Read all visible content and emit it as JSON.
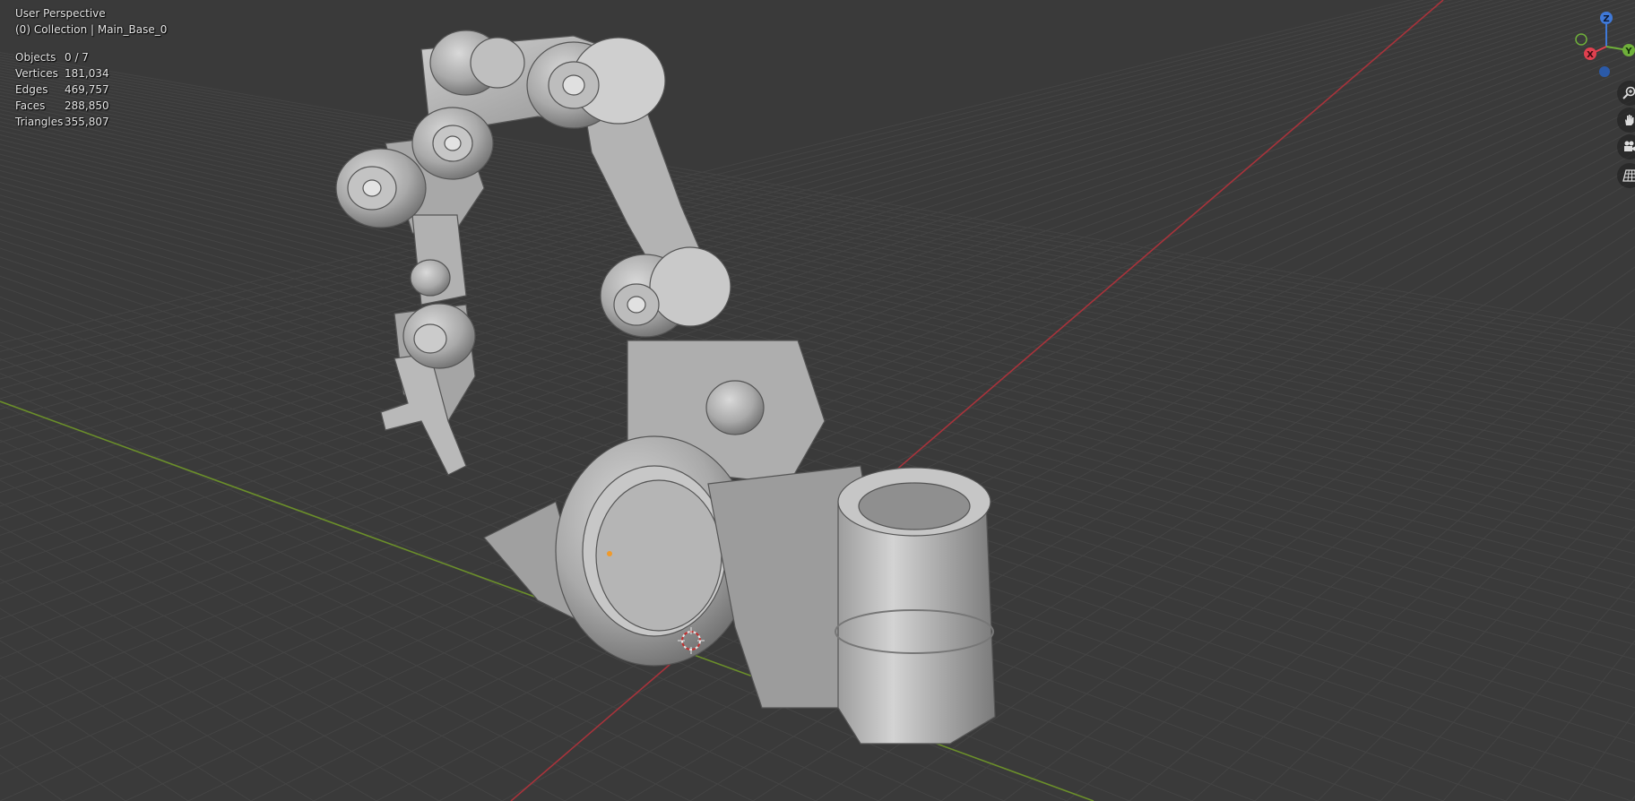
{
  "viewport": {
    "view_name": "User Perspective",
    "collection_line": "(0) Collection | Main_Base_0",
    "stats": [
      {
        "label": "Objects",
        "value": "0 / 7"
      },
      {
        "label": "Vertices",
        "value": "181,034"
      },
      {
        "label": "Edges",
        "value": "469,757"
      },
      {
        "label": "Faces",
        "value": "288,850"
      },
      {
        "label": "Triangles",
        "value": "355,807"
      }
    ]
  },
  "gizmo": {
    "axis_z_label": "Z",
    "axis_x_label": "X",
    "axis_y_label": "Y",
    "colors": {
      "x": "#e0404f",
      "y": "#6fb03a",
      "z": "#3f79d8"
    }
  },
  "nav_buttons": [
    {
      "icon": "zoom-icon"
    },
    {
      "icon": "hand-pan-icon"
    },
    {
      "icon": "camera-icon"
    },
    {
      "icon": "grid-perspective-icon"
    }
  ],
  "grid": {
    "background": "#3a3a3a",
    "line_color": "#444444",
    "x_axis_color": "#a8333b",
    "y_axis_color": "#6b8f2a"
  }
}
